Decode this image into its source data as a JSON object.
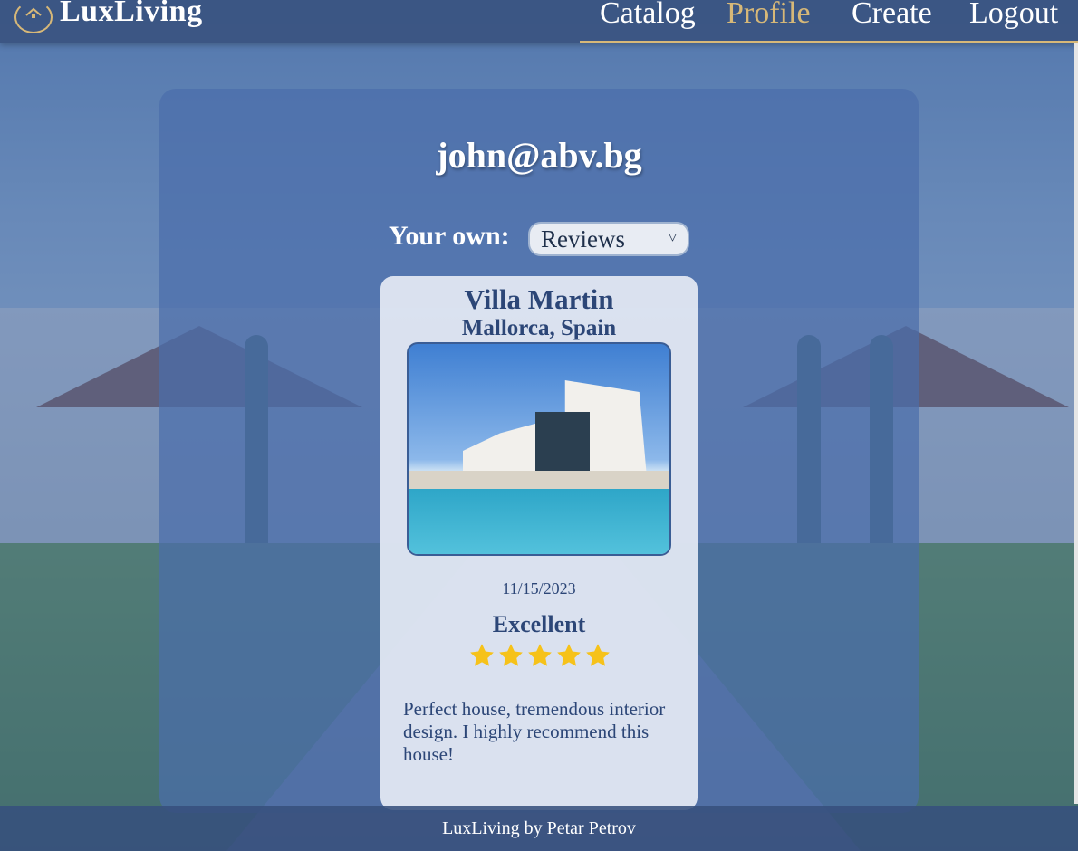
{
  "brand": {
    "name": "LuxLiving",
    "accent": "#d7b878"
  },
  "nav": {
    "items": [
      {
        "label": "Catalog",
        "active": false
      },
      {
        "label": "Profile",
        "active": true
      },
      {
        "label": "Create",
        "active": false
      },
      {
        "label": "Logout",
        "active": false
      }
    ]
  },
  "profile": {
    "email": "john@abv.bg",
    "own_label": "Your own:",
    "own_select": {
      "selected": "Reviews"
    }
  },
  "review": {
    "title": "Villa Martin",
    "location": "Mallorca, Spain",
    "date": "11/15/2023",
    "rating_label": "Excellent",
    "stars": 5,
    "stars_max": 5,
    "star_color": "#f6c21a",
    "text": "Perfect house, tremendous interior design. I highly recommend this house!"
  },
  "footer": {
    "text": "LuxLiving by Petar Petrov"
  }
}
